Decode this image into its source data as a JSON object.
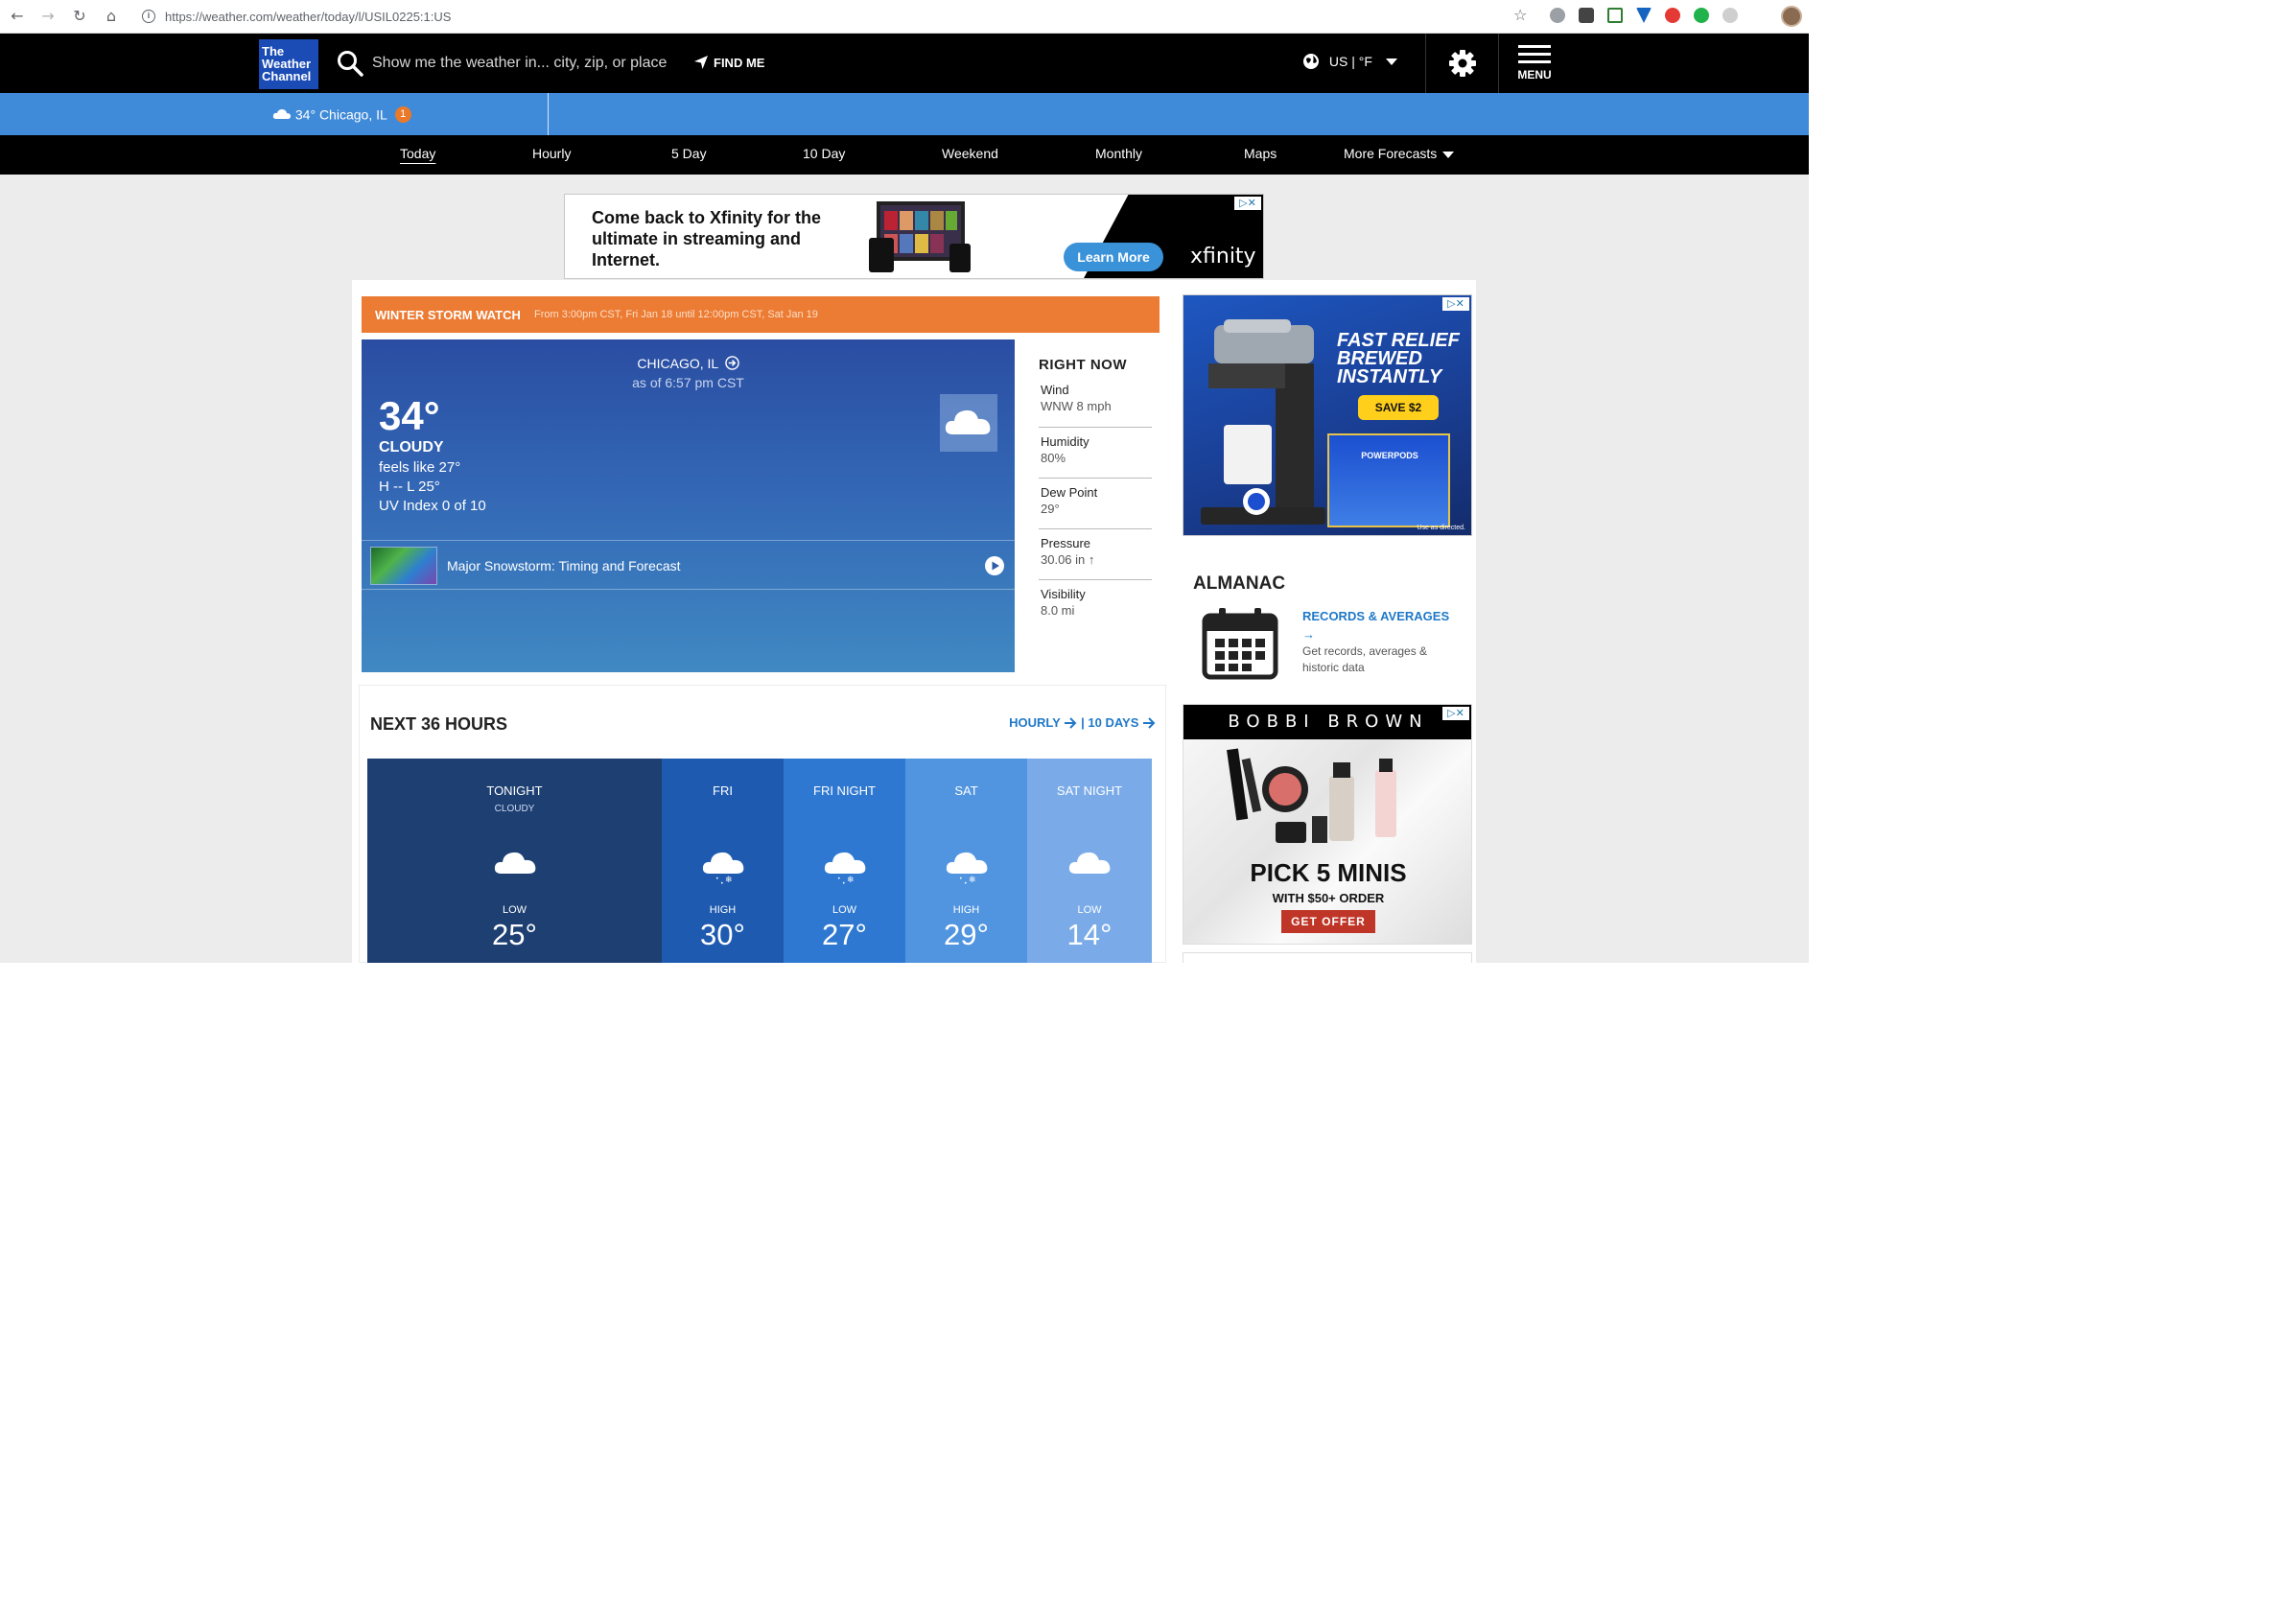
{
  "browser": {
    "url": "https://weather.com/weather/today/l/USIL0225:1:US"
  },
  "header": {
    "logo_line1": "The",
    "logo_line2": "Weather",
    "logo_line3": "Channel",
    "search_placeholder": "Show me the weather in... city, zip, or place",
    "find_me": "FIND ME",
    "locale": "US  |  °F",
    "menu": "MENU"
  },
  "location_strip": {
    "current": "34° Chicago, IL",
    "badge": "1"
  },
  "tabs": [
    "Today",
    "Hourly",
    "5 Day",
    "10 Day",
    "Weekend",
    "Monthly",
    "Maps",
    "More Forecasts"
  ],
  "ad_top": {
    "text": "Come back to Xfinity for the ultimate in streaming and Internet.",
    "button": "Learn More",
    "brand": "xfinity"
  },
  "alert": {
    "title": "WINTER STORM WATCH",
    "detail": "From 3:00pm CST, Fri Jan 18 until 12:00pm CST, Sat Jan 19"
  },
  "today": {
    "city": "CHICAGO, IL",
    "as_of": "as of 6:57 pm CST",
    "temp": "34°",
    "phrase": "CLOUDY",
    "feels_like": "feels like 27°",
    "hilo": "H -- L 25°",
    "uv": "UV Index 0 of 10",
    "video_title": "Major Snowstorm: Timing and Forecast"
  },
  "right_now": {
    "title": "RIGHT NOW",
    "items": [
      {
        "label": "Wind",
        "value": "WNW 8 mph"
      },
      {
        "label": "Humidity",
        "value": "80%"
      },
      {
        "label": "Dew Point",
        "value": "29°"
      },
      {
        "label": "Pressure",
        "value": "30.06 in ↑"
      },
      {
        "label": "Visibility",
        "value": "8.0 mi"
      }
    ]
  },
  "next36": {
    "title": "NEXT 36 HOURS",
    "hourly_link": "HOURLY",
    "tenday_link": "10 DAYS",
    "periods": [
      {
        "name": "TONIGHT",
        "phrase": "CLOUDY",
        "kind": "LOW",
        "temp": "25°",
        "color": "#1d3f72",
        "icon": "cloud"
      },
      {
        "name": "FRI",
        "phrase": "",
        "kind": "HIGH",
        "temp": "30°",
        "color": "#1e5bb0",
        "icon": "snow"
      },
      {
        "name": "FRI NIGHT",
        "phrase": "",
        "kind": "LOW",
        "temp": "27°",
        "color": "#2e78d1",
        "icon": "snow"
      },
      {
        "name": "SAT",
        "phrase": "",
        "kind": "HIGH",
        "temp": "29°",
        "color": "#5195e0",
        "icon": "snow"
      },
      {
        "name": "SAT NIGHT",
        "phrase": "",
        "kind": "LOW",
        "temp": "14°",
        "color": "#7aabe8",
        "icon": "cloud"
      }
    ]
  },
  "ad_coffee": {
    "headline": "FAST RELIEF BREWED INSTANTLY",
    "button": "SAVE $2",
    "box_text": "POWERPODS",
    "fine": "Use as directed."
  },
  "almanac": {
    "title": "ALMANAC",
    "link": "RECORDS & AVERAGES →",
    "description": "Get records, averages & historic data"
  },
  "ad_bb": {
    "brand": "BOBBI BROWN",
    "headline": "PICK 5 MINIS",
    "subline": "WITH $50+ ORDER",
    "button": "GET OFFER"
  }
}
